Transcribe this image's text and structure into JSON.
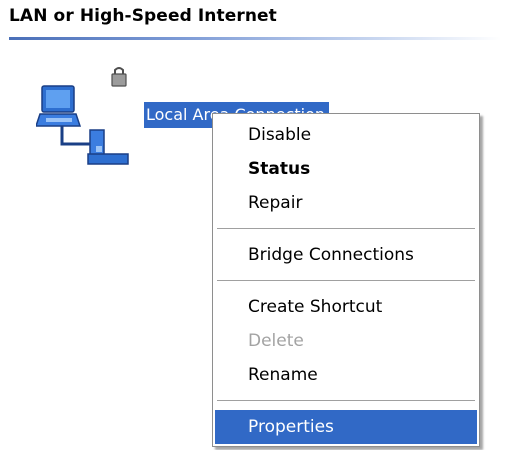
{
  "group": {
    "title": "LAN or High-Speed Internet"
  },
  "connection": {
    "icon": "network-connection-icon",
    "label": "Local Area Connection"
  },
  "context_menu": {
    "items": [
      {
        "label": "Disable",
        "bold": false,
        "enabled": true
      },
      {
        "label": "Status",
        "bold": true,
        "enabled": true
      },
      {
        "label": "Repair",
        "bold": false,
        "enabled": true
      },
      {
        "label": "Bridge Connections",
        "bold": false,
        "enabled": true
      },
      {
        "label": "Create Shortcut",
        "bold": false,
        "enabled": true
      },
      {
        "label": "Delete",
        "bold": false,
        "enabled": false
      },
      {
        "label": "Rename",
        "bold": false,
        "enabled": true
      },
      {
        "label": "Properties",
        "bold": false,
        "enabled": true,
        "highlighted": true
      }
    ]
  },
  "colors": {
    "selection": "#3169c6",
    "disabled_text": "#a3a3a3",
    "menu_border": "#8e8e8e"
  }
}
